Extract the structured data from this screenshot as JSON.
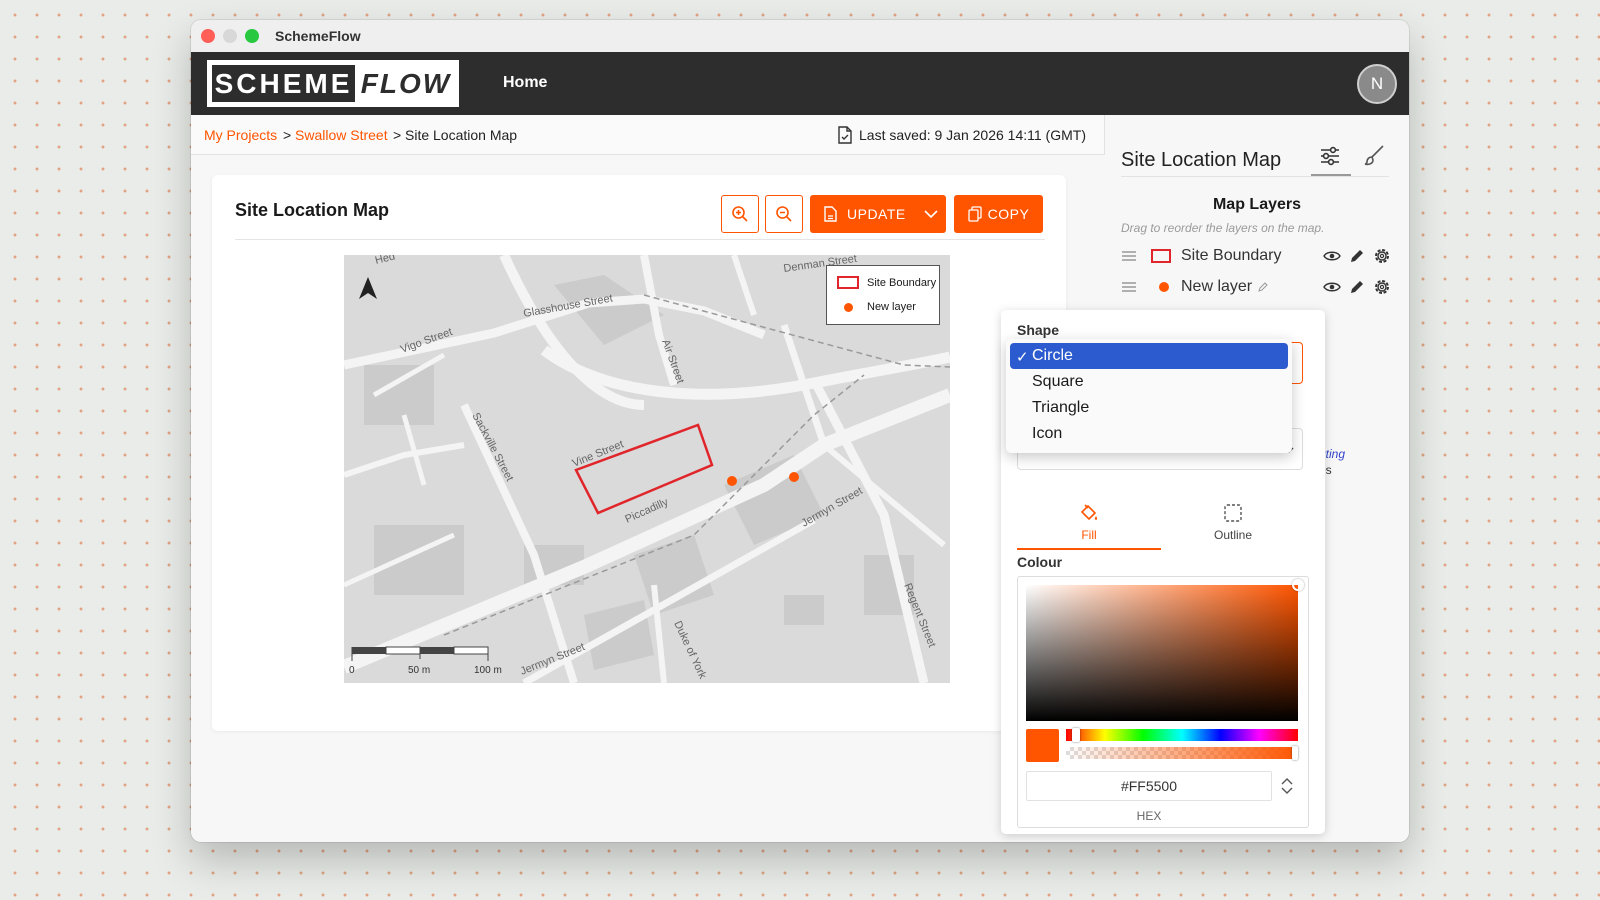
{
  "window": {
    "title": "SchemeFlow"
  },
  "navbar": {
    "logo_part1": "SCHEME",
    "logo_part2": "FLOW",
    "home_label": "Home",
    "avatar_initial": "N"
  },
  "breadcrumb": {
    "projects": "My Projects",
    "sep1": ">",
    "project": "Swallow Street",
    "sep2": ">",
    "current": "Site Location Map"
  },
  "last_saved": "Last saved: 9 Jan 2026 14:11 (GMT)",
  "card": {
    "title": "Site Location Map",
    "update_label": "UPDATE",
    "copy_label": "COPY"
  },
  "map": {
    "legend": [
      "Site Boundary",
      "New layer"
    ],
    "streets": {
      "denman": "Denman Street",
      "glasshouse": "Glasshouse Street",
      "vigo": "Vigo Street",
      "air": "Air Street",
      "sackville": "Sackville Street",
      "vine": "Vine Street",
      "piccadilly": "Piccadilly",
      "jermyn1": "Jermyn Street",
      "jermyn2": "Jermyn Street",
      "duke": "Duke of York",
      "regent": "Regent Street",
      "heddon": "Hed"
    },
    "scale": [
      "0",
      "50 m",
      "100 m"
    ],
    "accent_color": "#FF5500",
    "boundary_color": "#E0252B"
  },
  "side": {
    "title": "Site Location Map",
    "layers_heading": "Map Layers",
    "layers_hint": "Drag to reorder the layers on the map.",
    "layers": [
      "Site Boundary",
      "New layer"
    ],
    "partial_text_1": "uting",
    "partial_text_2": "es"
  },
  "popup": {
    "shape_label": "Shape",
    "options": [
      "Circle",
      "Square",
      "Triangle",
      "Icon"
    ],
    "selected": "Circle",
    "tabs": {
      "fill": "Fill",
      "outline": "Outline"
    },
    "colour_label": "Colour",
    "hex_value": "#FF5500",
    "hex_label": "HEX"
  }
}
